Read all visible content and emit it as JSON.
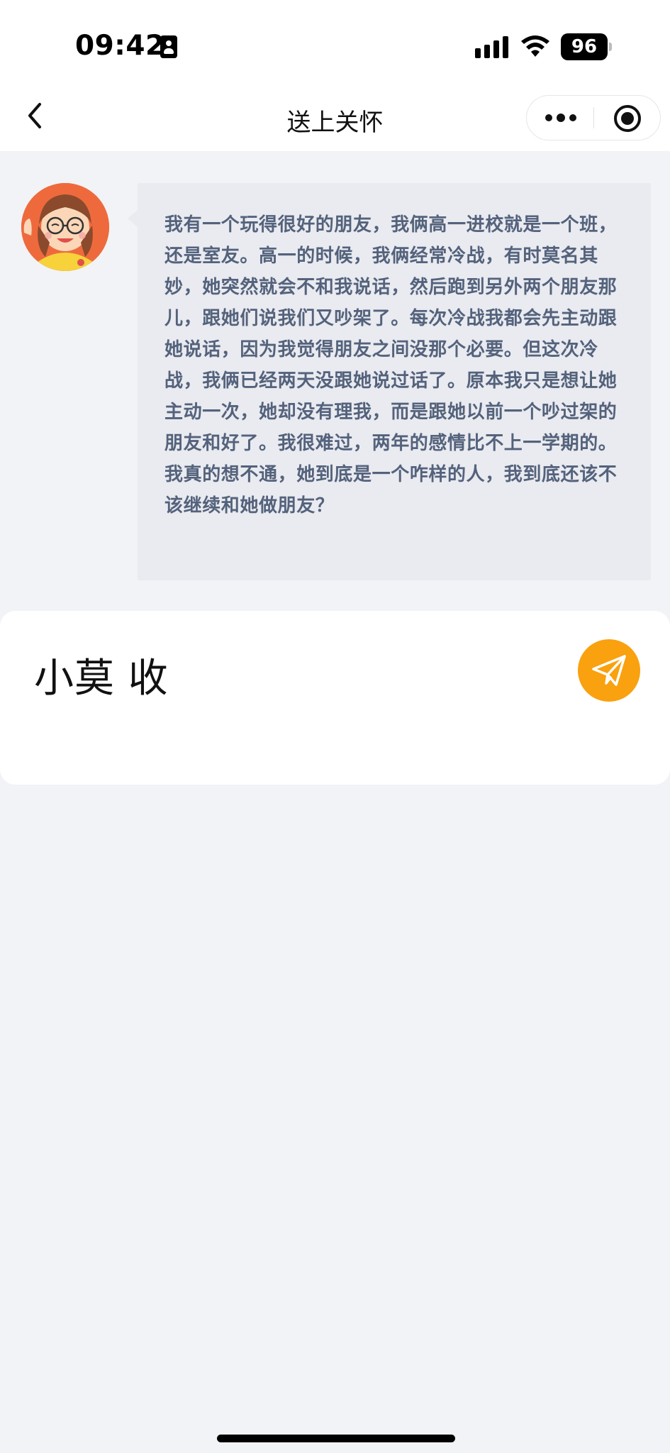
{
  "status_bar": {
    "time": "09:42",
    "battery": "96"
  },
  "nav": {
    "title": "送上关怀"
  },
  "message": {
    "text": "我有一个玩得很好的朋友，我俩高一进校就是一个班，还是室友。高一的时候，我俩经常冷战，有时莫名其妙，她突然就会不和我说话，然后跑到另外两个朋友那儿，跟她们说我们又吵架了。每次冷战我都会先主动跟她说话，因为我觉得朋友之间没那个必要。但这次冷战，我俩已经两天没跟她说过话了。原本我只是想让她主动一次，她却没有理我，而是跟她以前一个吵过架的朋友和好了。我很难过，两年的感情比不上一学期的。我真的想不通，她到底是一个咋样的人，我到底还该不该继续和她做朋友？"
  },
  "reply": {
    "text": "小莫 收"
  },
  "icons": {
    "back": "chevron-left-icon",
    "more": "more-dots-icon",
    "close": "target-close-icon",
    "send": "paper-plane-icon"
  },
  "colors": {
    "page_background": "#f2f3f6",
    "bubble_background": "#e9ebf0",
    "bubble_text": "#54627c",
    "send_button": "#f9a10e"
  }
}
